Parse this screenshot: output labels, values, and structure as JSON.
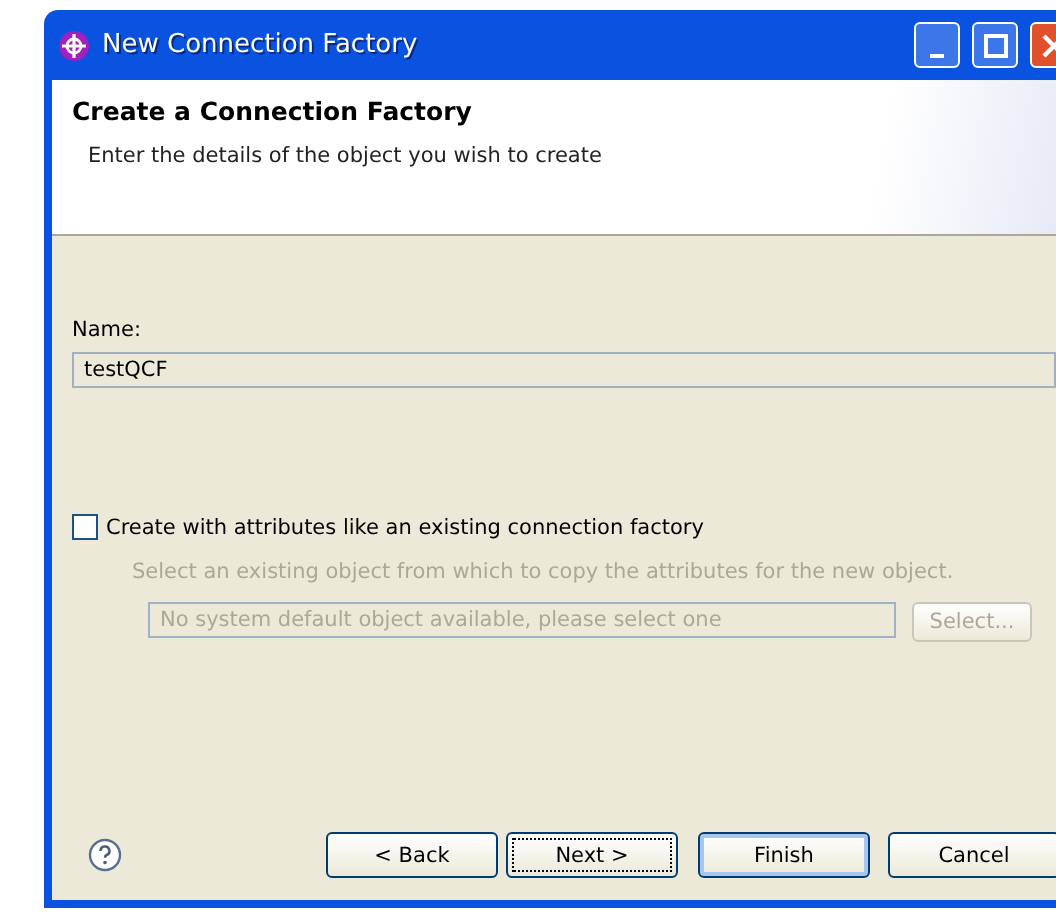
{
  "window": {
    "title": "New Connection Factory"
  },
  "header": {
    "title": "Create a Connection Factory",
    "description": "Enter the details of the object you wish to create"
  },
  "name_field": {
    "label": "Name:",
    "value": "testQCF"
  },
  "copy_option": {
    "label": "Create with attributes like an existing connection factory",
    "checked": false
  },
  "copy_source": {
    "description": "Select an existing object from which to copy the attributes for the new object.",
    "value": "No system default object available, please select one",
    "button": "Select...",
    "disabled": true
  },
  "buttons": [
    {
      "label": "< Back",
      "focused": false,
      "default": false
    },
    {
      "label": "Next >",
      "focused": true,
      "default": false
    },
    {
      "label": "Finish",
      "focused": false,
      "default": true
    },
    {
      "label": "Cancel",
      "focused": false,
      "default": false
    }
  ]
}
